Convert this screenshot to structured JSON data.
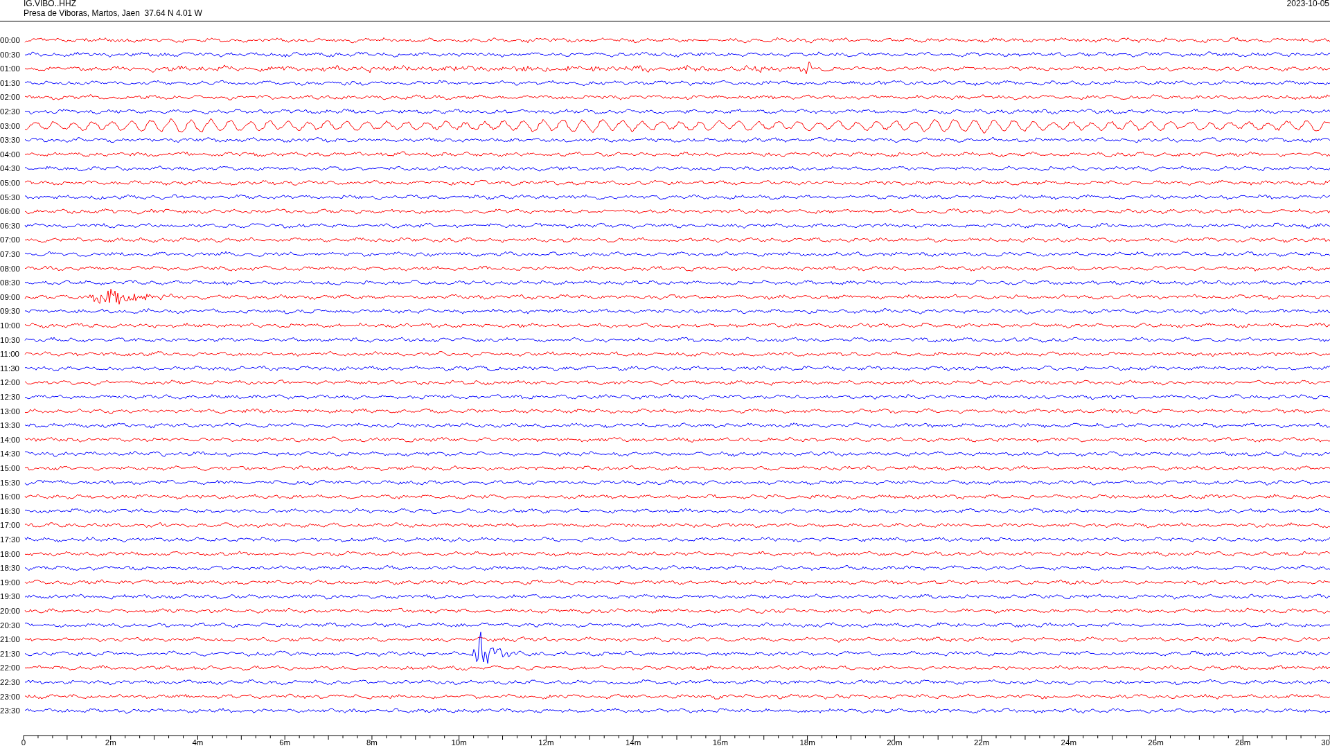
{
  "header": {
    "channel": "IG.VIBO..HHZ",
    "location": "Presa de Viboras, Martos, Jaen  37.64 N 4.01 W",
    "date": "2023-10-05"
  },
  "rows": [
    {
      "label": "00:00",
      "color": "#ff0000",
      "kind": "plain"
    },
    {
      "label": "00:30",
      "color": "#0000ff",
      "kind": "plain"
    },
    {
      "label": "01:00",
      "color": "#ff0000",
      "kind": "burst"
    },
    {
      "label": "01:30",
      "color": "#0000ff",
      "kind": "plain"
    },
    {
      "label": "02:00",
      "color": "#ff0000",
      "kind": "plain"
    },
    {
      "label": "02:30",
      "color": "#0000ff",
      "kind": "plain"
    },
    {
      "label": "03:00",
      "color": "#ff0000",
      "kind": "swell"
    },
    {
      "label": "03:30",
      "color": "#0000ff",
      "kind": "plain"
    },
    {
      "label": "04:00",
      "color": "#ff0000",
      "kind": "plain"
    },
    {
      "label": "04:30",
      "color": "#0000ff",
      "kind": "plain"
    },
    {
      "label": "05:00",
      "color": "#ff0000",
      "kind": "plain"
    },
    {
      "label": "05:30",
      "color": "#0000ff",
      "kind": "plain"
    },
    {
      "label": "06:00",
      "color": "#ff0000",
      "kind": "plain"
    },
    {
      "label": "06:30",
      "color": "#0000ff",
      "kind": "plain"
    },
    {
      "label": "07:00",
      "color": "#ff0000",
      "kind": "plain"
    },
    {
      "label": "07:30",
      "color": "#0000ff",
      "kind": "plain"
    },
    {
      "label": "08:00",
      "color": "#ff0000",
      "kind": "plain"
    },
    {
      "label": "08:30",
      "color": "#0000ff",
      "kind": "plain"
    },
    {
      "label": "09:00",
      "color": "#ff0000",
      "kind": "quake"
    },
    {
      "label": "09:30",
      "color": "#0000ff",
      "kind": "plain"
    },
    {
      "label": "10:00",
      "color": "#ff0000",
      "kind": "plain"
    },
    {
      "label": "10:30",
      "color": "#0000ff",
      "kind": "plain"
    },
    {
      "label": "11:00",
      "color": "#ff0000",
      "kind": "plain"
    },
    {
      "label": "11:30",
      "color": "#0000ff",
      "kind": "plain"
    },
    {
      "label": "12:00",
      "color": "#ff0000",
      "kind": "plain"
    },
    {
      "label": "12:30",
      "color": "#0000ff",
      "kind": "plain"
    },
    {
      "label": "13:00",
      "color": "#ff0000",
      "kind": "plain"
    },
    {
      "label": "13:30",
      "color": "#0000ff",
      "kind": "plain"
    },
    {
      "label": "14:00",
      "color": "#ff0000",
      "kind": "plain"
    },
    {
      "label": "14:30",
      "color": "#0000ff",
      "kind": "plain"
    },
    {
      "label": "15:00",
      "color": "#ff0000",
      "kind": "plain"
    },
    {
      "label": "15:30",
      "color": "#0000ff",
      "kind": "plain"
    },
    {
      "label": "16:00",
      "color": "#ff0000",
      "kind": "plain"
    },
    {
      "label": "16:30",
      "color": "#0000ff",
      "kind": "plain"
    },
    {
      "label": "17:00",
      "color": "#ff0000",
      "kind": "plain"
    },
    {
      "label": "17:30",
      "color": "#0000ff",
      "kind": "plain"
    },
    {
      "label": "18:00",
      "color": "#ff0000",
      "kind": "plain"
    },
    {
      "label": "18:30",
      "color": "#0000ff",
      "kind": "plain"
    },
    {
      "label": "19:00",
      "color": "#ff0000",
      "kind": "plain"
    },
    {
      "label": "19:30",
      "color": "#0000ff",
      "kind": "plain"
    },
    {
      "label": "20:00",
      "color": "#ff0000",
      "kind": "plain"
    },
    {
      "label": "20:30",
      "color": "#0000ff",
      "kind": "plain"
    },
    {
      "label": "21:00",
      "color": "#ff0000",
      "kind": "plain"
    },
    {
      "label": "21:30",
      "color": "#0000ff",
      "kind": "strong-quake"
    },
    {
      "label": "22:00",
      "color": "#ff0000",
      "kind": "plain"
    },
    {
      "label": "22:30",
      "color": "#0000ff",
      "kind": "plain"
    },
    {
      "label": "23:00",
      "color": "#ff0000",
      "kind": "plain"
    },
    {
      "label": "23:30",
      "color": "#0000ff",
      "kind": "plain"
    }
  ],
  "x_axis": {
    "labels": [
      "0",
      "2m",
      "4m",
      "6m",
      "8m",
      "10m",
      "12m",
      "14m",
      "16m",
      "18m",
      "20m",
      "22m",
      "24m",
      "26m",
      "28m",
      "30"
    ]
  }
}
